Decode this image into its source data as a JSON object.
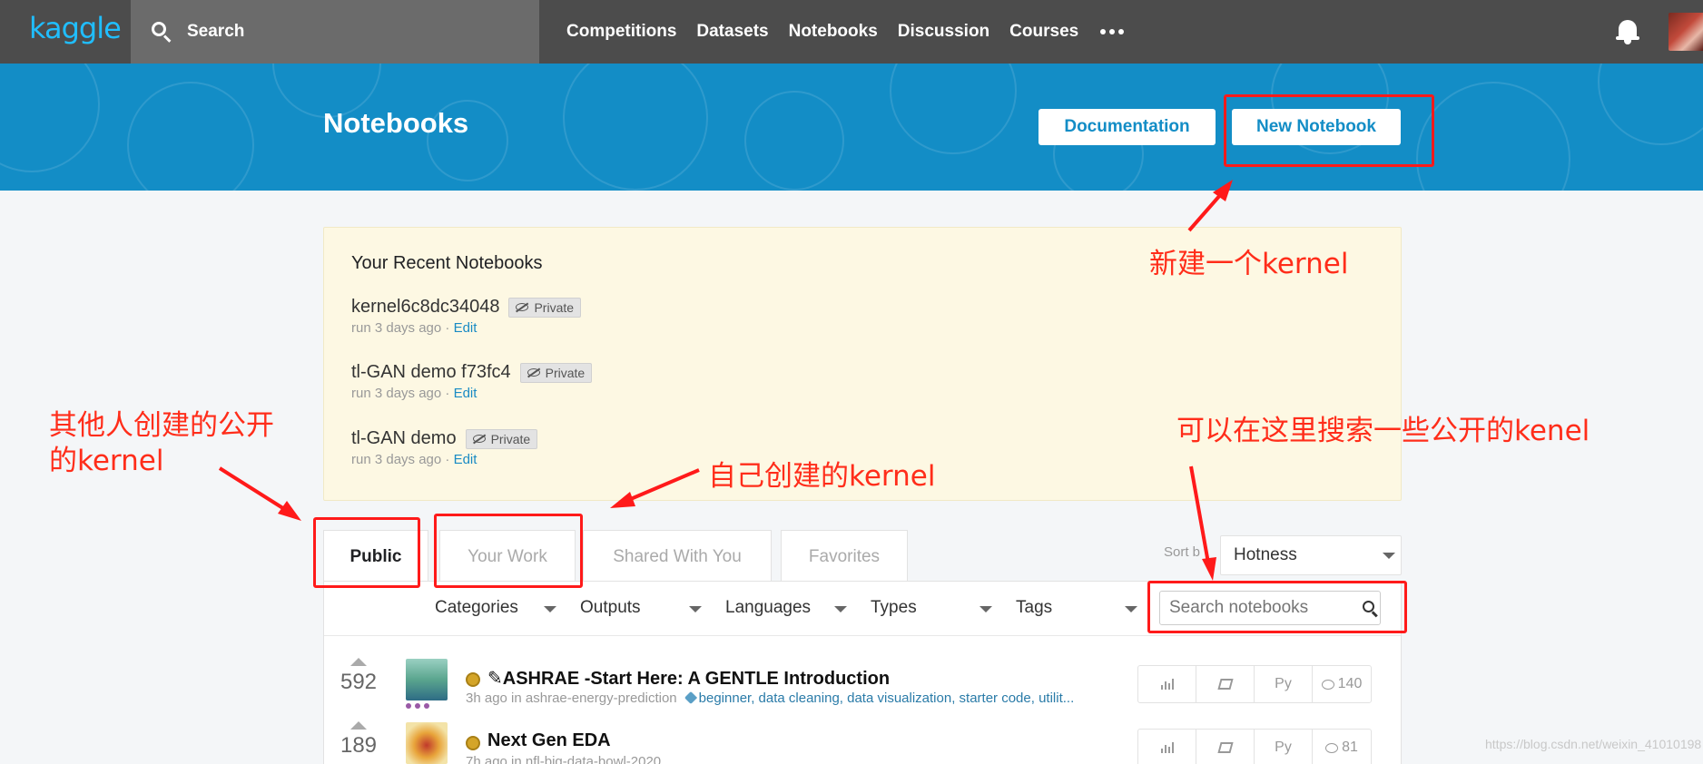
{
  "nav": {
    "logo": "kaggle",
    "search_placeholder": "Search",
    "links": [
      "Competitions",
      "Datasets",
      "Notebooks",
      "Discussion",
      "Courses"
    ]
  },
  "banner": {
    "title": "Notebooks",
    "documentation_label": "Documentation",
    "new_notebook_label": "New Notebook"
  },
  "recent": {
    "heading": "Your Recent Notebooks",
    "items": [
      {
        "name": "kernel6c8dc34048",
        "badge": "Private",
        "meta": "run 3 days ago · ",
        "edit": "Edit"
      },
      {
        "name": "tl-GAN demo f73fc4",
        "badge": "Private",
        "meta": "run 3 days ago · ",
        "edit": "Edit"
      },
      {
        "name": "tl-GAN demo",
        "badge": "Private",
        "meta": "run 3 days ago · ",
        "edit": "Edit"
      }
    ]
  },
  "tabs": [
    "Public",
    "Your Work",
    "Shared With You",
    "Favorites"
  ],
  "sort": {
    "label": "Sort b",
    "value": "Hotness"
  },
  "filters": [
    "Categories",
    "Outputs",
    "Languages",
    "Types",
    "Tags"
  ],
  "notebook_search_placeholder": "Search notebooks",
  "notebooks": [
    {
      "votes": "592",
      "title": "ASHRAE -Start Here: A GENTLE Introduction",
      "meta": "3h ago in ashrae-energy-prediction",
      "tags": "beginner, data cleaning, data visualization, starter code, utilit...",
      "language": "Py",
      "comments": "140"
    },
    {
      "votes": "189",
      "title": "Next Gen EDA",
      "meta": "7h ago in nfl-big-data-bowl-2020",
      "tags": "",
      "language": "Py",
      "comments": "81"
    }
  ],
  "annotations": {
    "new_kernel": "新建一个kernel",
    "public_kernel_line1": "其他人创建的公开",
    "public_kernel_line2": "的kernel",
    "own_kernel": "自己创建的kernel",
    "search_kernel": "可以在这里搜索一些公开的kenel"
  },
  "watermark": "https://blog.csdn.net/weixin_41010198",
  "colors": {
    "nav_bg": "#4c4c4c",
    "banner_bg": "#138dc6",
    "accent": "#20beff",
    "annotation_red": "#ff1a1a"
  }
}
